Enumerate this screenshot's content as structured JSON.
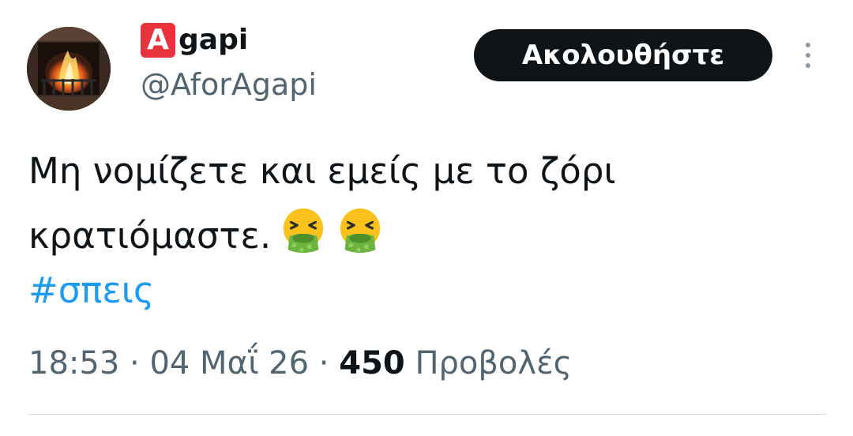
{
  "user": {
    "badge_letter": "A",
    "display_name": "gapi",
    "handle": "@AforAgapi",
    "avatar_icon": "fireplace-avatar"
  },
  "follow_button": {
    "label": "Ακολουθήστε"
  },
  "more_button_icon": "vertical-ellipsis-icon",
  "tweet": {
    "line1": "Μη νομίζετε και εμείς με το ζόρι",
    "line2": "κρατιόμαστε.",
    "emoji_icon": "face-vomiting-emoji",
    "emoji_count": 2,
    "hashtag": "#σπεις"
  },
  "meta": {
    "time": "18:53",
    "separator": " · ",
    "date": "04 Μαΐ 26",
    "views_count": "450",
    "views_label": " Προβολές"
  },
  "colors": {
    "text": "#0f1419",
    "secondary": "#536471",
    "link": "#1d9bf0",
    "badge": "#e8323c",
    "button": "#0f1419"
  }
}
